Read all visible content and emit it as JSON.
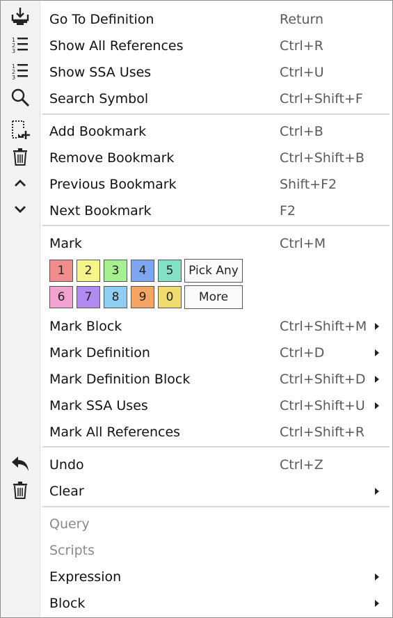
{
  "menu": {
    "items": [
      {
        "label": "Go To Definition",
        "shortcut": "Return"
      },
      {
        "label": "Show All References",
        "shortcut": "Ctrl+R"
      },
      {
        "label": "Show SSA Uses",
        "shortcut": "Ctrl+U"
      },
      {
        "label": "Search Symbol",
        "shortcut": "Ctrl+Shift+F"
      },
      {
        "label": "Add Bookmark",
        "shortcut": "Ctrl+B"
      },
      {
        "label": "Remove Bookmark",
        "shortcut": "Ctrl+Shift+B"
      },
      {
        "label": "Previous Bookmark",
        "shortcut": "Shift+F2"
      },
      {
        "label": "Next Bookmark",
        "shortcut": "F2"
      },
      {
        "label": "Mark",
        "shortcut": "Ctrl+M"
      },
      {
        "label": "Mark Block",
        "shortcut": "Ctrl+Shift+M",
        "submenu": true
      },
      {
        "label": "Mark Definition",
        "shortcut": "Ctrl+D",
        "submenu": true
      },
      {
        "label": "Mark Definition Block",
        "shortcut": "Ctrl+Shift+D",
        "submenu": true
      },
      {
        "label": "Mark SSA Uses",
        "shortcut": "Ctrl+Shift+U",
        "submenu": true
      },
      {
        "label": "Mark All References",
        "shortcut": "Ctrl+Shift+R"
      },
      {
        "label": "Undo",
        "shortcut": "Ctrl+Z"
      },
      {
        "label": "Clear",
        "shortcut": "",
        "submenu": true
      },
      {
        "label": "Query",
        "shortcut": "",
        "disabled": true
      },
      {
        "label": "Scripts",
        "shortcut": "",
        "disabled": true
      },
      {
        "label": "Expression",
        "shortcut": "",
        "submenu": true
      },
      {
        "label": "Block",
        "shortcut": "",
        "submenu": true
      }
    ],
    "mark_colors": [
      {
        "label": "1",
        "color": "#f28b8b"
      },
      {
        "label": "2",
        "color": "#f5f58a"
      },
      {
        "label": "3",
        "color": "#a6f08f"
      },
      {
        "label": "4",
        "color": "#7fa6f2"
      },
      {
        "label": "5",
        "color": "#84e0c4"
      },
      {
        "label": "6",
        "color": "#f2a2cf"
      },
      {
        "label": "7",
        "color": "#b08af0"
      },
      {
        "label": "8",
        "color": "#8ccff2"
      },
      {
        "label": "9",
        "color": "#f5a561"
      },
      {
        "label": "0",
        "color": "#f0dc6e"
      }
    ],
    "pick_any_label": "Pick Any",
    "more_label": "More"
  }
}
